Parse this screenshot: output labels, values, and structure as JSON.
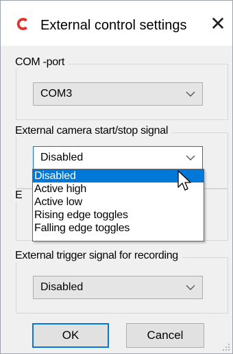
{
  "window": {
    "title": "External control settings",
    "close_glyph": "✕",
    "icon": "app-c-logo-icon",
    "accent_color": "#0078d7",
    "icon_color": "#e0352b"
  },
  "groups": {
    "com_port": {
      "legend": "COM -port",
      "selected": "COM3"
    },
    "camera_signal": {
      "legend": "External camera start/stop signal",
      "selected": "Disabled",
      "options": [
        "Disabled",
        "Active high",
        "Active low",
        "Rising edge toggles",
        "Falling edge toggles"
      ],
      "highlighted_option": "Disabled"
    },
    "hidden_group": {
      "legend_partial": "E"
    },
    "trigger_signal": {
      "legend": "External trigger signal for recording",
      "selected": "Disabled"
    }
  },
  "buttons": {
    "ok_label": "OK",
    "cancel_label": "Cancel"
  }
}
